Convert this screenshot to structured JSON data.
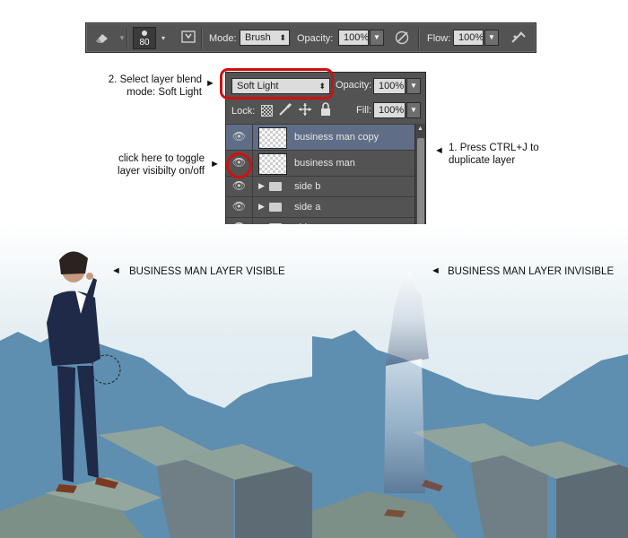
{
  "toolbar": {
    "brush_size": "80",
    "mode_label": "Mode:",
    "mode_value": "Brush",
    "opacity_label": "Opacity:",
    "opacity_value": "100%",
    "flow_label": "Flow:",
    "flow_value": "100%"
  },
  "layers_panel": {
    "blend_mode": "Soft Light",
    "opacity_label": "Opacity:",
    "opacity_value": "100%",
    "lock_label": "Lock:",
    "fill_label": "Fill:",
    "fill_value": "100%",
    "layers": [
      {
        "name": "business man copy",
        "type": "layer",
        "selected": true
      },
      {
        "name": "business man",
        "type": "layer",
        "selected": false
      },
      {
        "name": "side b",
        "type": "group",
        "selected": false
      },
      {
        "name": "side a",
        "type": "group",
        "selected": false
      },
      {
        "name": "side c",
        "type": "group",
        "selected": false
      }
    ]
  },
  "annotations": {
    "blend_note": "2. Select layer blend\nmode: Soft Light",
    "toggle_note": "click here to toggle\nlayer visibilty on/off",
    "duplicate_note": "1. Press CTRL+J to\nduplicate layer",
    "visible_caption": "BUSINESS MAN LAYER VISIBLE",
    "invisible_caption": "BUSINESS MAN LAYER INVISIBLE"
  },
  "colors": {
    "panel_bg": "#535353",
    "selected_layer": "#5f6e86",
    "highlight_ring": "#d01010",
    "sky": "#e4eef2",
    "mountains": "#5e8eb0",
    "concrete": "#7d9087"
  }
}
